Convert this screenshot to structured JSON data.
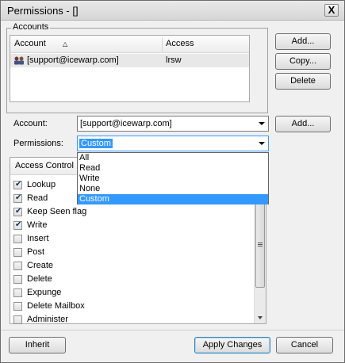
{
  "window": {
    "title": "Permissions - []",
    "close_glyph": "X"
  },
  "accounts": {
    "group_label": "Accounts",
    "columns": {
      "account": "Account",
      "sort_glyph": "△",
      "access": "Access"
    },
    "rows": [
      {
        "account": "[support@icewarp.com]",
        "access": "lrsw",
        "icon": "users-icon"
      }
    ],
    "buttons": {
      "add": "Add...",
      "copy": "Copy...",
      "delete": "Delete"
    }
  },
  "form": {
    "account_label": "Account:",
    "account_value": "[support@icewarp.com]",
    "add_button": "Add...",
    "permissions_label": "Permissions:",
    "permissions_value": "Custom",
    "permissions_options": [
      "All",
      "Read",
      "Write",
      "None",
      "Custom"
    ],
    "permissions_selected_index": 4
  },
  "access_control": {
    "header": "Access Control",
    "items": [
      {
        "label": "Lookup",
        "checked": true
      },
      {
        "label": "Read",
        "checked": true
      },
      {
        "label": "Keep Seen flag",
        "checked": true
      },
      {
        "label": "Write",
        "checked": true
      },
      {
        "label": "Insert",
        "checked": false
      },
      {
        "label": "Post",
        "checked": false
      },
      {
        "label": "Create",
        "checked": false
      },
      {
        "label": "Delete",
        "checked": false
      },
      {
        "label": "Expunge",
        "checked": false
      },
      {
        "label": "Delete Mailbox",
        "checked": false
      },
      {
        "label": "Administer",
        "checked": false
      }
    ]
  },
  "footer": {
    "inherit": "Inherit",
    "apply": "Apply Changes",
    "cancel": "Cancel"
  },
  "colors": {
    "selection": "#3399ff",
    "window_bg": "#f0f0f0"
  }
}
